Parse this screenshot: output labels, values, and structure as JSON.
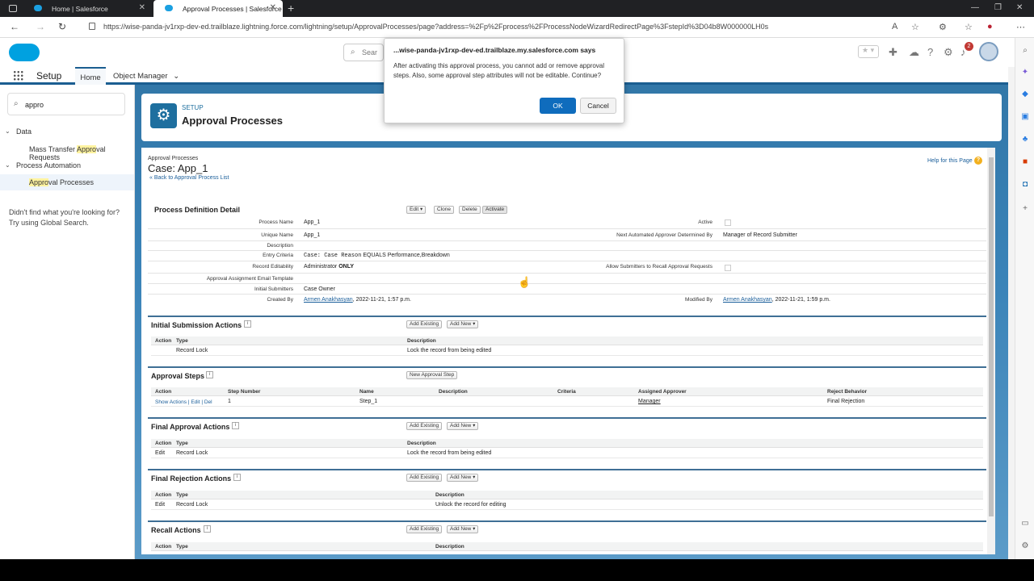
{
  "browser": {
    "tabs": [
      {
        "title": "Home | Salesforce"
      },
      {
        "title": "Approval Processes | Salesforce"
      }
    ],
    "url": "https://wise-panda-jv1rxp-dev-ed.trailblaze.lightning.force.com/lightning/setup/ApprovalProcesses/page?address=%2Fp%2Fprocess%2FProcessNodeWizardRedirectPage%3FstepId%3D04b8W000000LH0s",
    "notification_count": "2"
  },
  "header": {
    "search_placeholder": "Sear",
    "setup_title": "Setup",
    "nav_home": "Home",
    "nav_object_manager": "Object Manager"
  },
  "sidebar": {
    "quick_find_value": "appro",
    "groups": [
      {
        "label": "Data",
        "items": [
          {
            "pre": "Mass Transfer ",
            "hl": "Appro",
            "post": "val Requests"
          }
        ]
      },
      {
        "label": "Process Automation",
        "items": [
          {
            "pre": "",
            "hl": "Appro",
            "post": "val Processes"
          }
        ]
      }
    ],
    "hint_line1": "Didn't find what you're looking for?",
    "hint_line2": "Try using Global Search."
  },
  "setup_header": {
    "label": "SETUP",
    "title": "Approval Processes"
  },
  "page": {
    "breadcrumb": "Approval Processes",
    "title": "Case: App_1",
    "back_link": "« Back to Approval Process List",
    "help_link": "Help for this Page",
    "help_icon_glyph": "?"
  },
  "detail": {
    "title": "Process Definition Detail",
    "buttons": {
      "edit": "Edit",
      "clone": "Clone",
      "delete": "Delete",
      "activate": "Activate"
    },
    "fields": {
      "process_name_label": "Process Name",
      "process_name": "App_1",
      "unique_name_label": "Unique Name",
      "unique_name": "App_1",
      "description_label": "Description",
      "entry_criteria_label": "Entry Criteria",
      "entry_criteria_code": "Case: Case Reason",
      "entry_criteria_rest": " EQUALS Performance,Breakdown",
      "record_editability_label": "Record Editability",
      "record_editability": "Administrator ",
      "record_editability_bold": "ONLY",
      "email_template_label": "Approval Assignment Email Template",
      "initial_submitters_label": "Initial Submitters",
      "initial_submitters": "Case Owner",
      "created_by_label": "Created By",
      "created_by_user": "Armen Anakhasyan",
      "created_by_date": ", 2022-11-21, 1:57 p.m.",
      "active_label": "Active",
      "next_approver_label": "Next Automated Approver Determined By",
      "next_approver": "Manager of Record Submitter",
      "allow_recall_label": "Allow Submitters to Recall Approval Requests",
      "modified_by_label": "Modified By",
      "modified_by_user": "Armen Anakhasyan",
      "modified_by_date": ", 2022-11-21, 1:59 p.m."
    }
  },
  "sections": {
    "add_existing": "Add Existing",
    "add_new": "Add New",
    "col_action": "Action",
    "col_type": "Type",
    "col_description": "Description",
    "initial_submission": {
      "title": "Initial Submission Actions",
      "row": {
        "action": "",
        "type": "Record Lock",
        "description": "Lock the record from being edited"
      }
    },
    "approval_steps": {
      "title": "Approval Steps",
      "new_step_button": "New Approval Step",
      "columns": [
        "Action",
        "Step Number",
        "Name",
        "Description",
        "Criteria",
        "Assigned Approver",
        "Reject Behavior"
      ],
      "row": {
        "show_actions": "Show Actions",
        "edit": "Edit",
        "del": "Del",
        "step_number": "1",
        "name": "Step_1",
        "description": "",
        "criteria": "",
        "approver": "Manager",
        "reject": "Final Rejection"
      }
    },
    "final_approval": {
      "title": "Final Approval Actions",
      "row": {
        "action": "Edit",
        "type": "Record Lock",
        "description": "Lock the record from being edited"
      }
    },
    "final_rejection": {
      "title": "Final Rejection Actions",
      "row": {
        "action": "Edit",
        "type": "Record Lock",
        "description": "Unlock the record for editing"
      }
    },
    "recall": {
      "title": "Recall Actions"
    }
  },
  "dialog": {
    "title": "...wise-panda-jv1rxp-dev-ed.trailblaze.my.salesforce.com says",
    "message": "After activating this approval process, you cannot add or remove approval steps. Also, some approval step attributes will not be editable. Continue?",
    "ok": "OK",
    "cancel": "Cancel"
  },
  "colors": {
    "brand_blue": "#00a1e0",
    "setup_blue": "#1e6f9f",
    "dialog_ok": "#0f6cbd"
  }
}
